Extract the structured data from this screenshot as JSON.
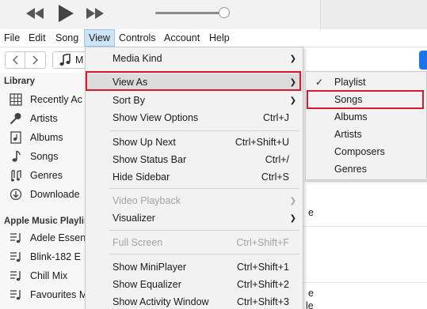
{
  "menubar": {
    "items": [
      {
        "label": "File"
      },
      {
        "label": "Edit"
      },
      {
        "label": "Song"
      },
      {
        "label": "View"
      },
      {
        "label": "Controls"
      },
      {
        "label": "Account"
      },
      {
        "label": "Help"
      }
    ]
  },
  "toolbar": {
    "media_picker_text": "M",
    "volume_level": 0.93
  },
  "sidebar": {
    "library_heading": "Library",
    "library_items": [
      {
        "label": "Recently Ac",
        "icon": "recently-added-icon"
      },
      {
        "label": "Artists",
        "icon": "microphone-icon"
      },
      {
        "label": "Albums",
        "icon": "album-icon"
      },
      {
        "label": "Songs",
        "icon": "music-note-icon"
      },
      {
        "label": "Genres",
        "icon": "genres-icon"
      },
      {
        "label": "Downloade",
        "icon": "download-icon"
      }
    ],
    "playlists_heading": "Apple Music Playlis",
    "playlist_items": [
      {
        "label": "Adele Essen",
        "icon": "playlist-icon"
      },
      {
        "label": "Blink-182 E",
        "icon": "playlist-icon"
      },
      {
        "label": "Chill Mix",
        "icon": "playlist-icon"
      },
      {
        "label": "Favourites M",
        "icon": "playlist-icon"
      }
    ]
  },
  "content": {
    "fragments": [
      "e",
      "e",
      "le"
    ]
  },
  "view_menu": {
    "items": [
      {
        "label": "Media Kind",
        "shortcut": "",
        "submenu": true
      },
      {
        "label": "View As",
        "shortcut": "",
        "submenu": true
      },
      {
        "label": "Sort By",
        "shortcut": "",
        "submenu": true
      },
      {
        "label": "Show View Options",
        "shortcut": "Ctrl+J"
      },
      {
        "label": "Show Up Next",
        "shortcut": "Ctrl+Shift+U"
      },
      {
        "label": "Show Status Bar",
        "shortcut": "Ctrl+/"
      },
      {
        "label": "Hide Sidebar",
        "shortcut": "Ctrl+S"
      },
      {
        "label": "Video Playback",
        "shortcut": "",
        "submenu": true,
        "disabled": true
      },
      {
        "label": "Visualizer",
        "shortcut": "",
        "submenu": true
      },
      {
        "label": "Full Screen",
        "shortcut": "Ctrl+Shift+F",
        "disabled": true
      },
      {
        "label": "Show MiniPlayer",
        "shortcut": "Ctrl+Shift+1"
      },
      {
        "label": "Show Equalizer",
        "shortcut": "Ctrl+Shift+2"
      },
      {
        "label": "Show Activity Window",
        "shortcut": "Ctrl+Shift+3"
      }
    ]
  },
  "view_as_submenu": {
    "checkmark": "✓",
    "items": [
      {
        "label": "Playlist",
        "checked": true
      },
      {
        "label": "Songs"
      },
      {
        "label": "Albums"
      },
      {
        "label": "Artists"
      },
      {
        "label": "Composers"
      },
      {
        "label": "Genres"
      }
    ]
  },
  "colors": {
    "highlight_outline": "#d7192c",
    "menu_background": "#f2f2f2",
    "accent_blue": "#1a73e8"
  }
}
